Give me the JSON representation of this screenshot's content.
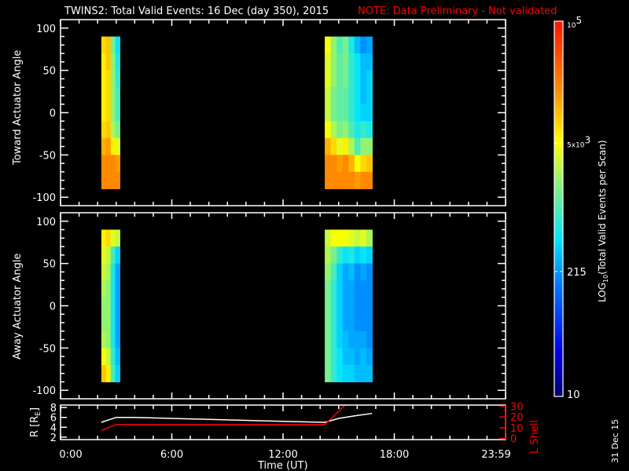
{
  "header": {
    "title": "TWINS2: Total Valid Events: 16 Dec (day 350), 2015",
    "note": "NOTE: Data Preliminary - Not validated",
    "note_color": "#ff0000"
  },
  "side_date": "31 Dec 15",
  "chart_data": [
    {
      "type": "heatmap",
      "ylabel": "Toward Actuator Angle",
      "ylim": [
        -110,
        110
      ],
      "yticks": [
        "100",
        "50",
        "0",
        "-50",
        "-100"
      ],
      "xlim_hours": [
        0,
        24
      ],
      "angle_bins_center": [
        80,
        60,
        40,
        20,
        0,
        -20,
        -40,
        -60,
        -80
      ],
      "angle_bin_width": 20,
      "value_units": "log10 counts",
      "blocks": [
        {
          "start_hours": [
            2.2,
            2.45,
            2.7,
            2.95
          ],
          "col_width_hours": 0.25,
          "columns": [
            [
              3.9,
              3.8,
              3.8,
              3.8,
              3.8,
              3.9,
              4.1,
              4.3,
              4.3
            ],
            [
              4.0,
              4.0,
              3.9,
              3.9,
              3.9,
              4.0,
              4.2,
              4.3,
              4.3
            ],
            [
              3.2,
              3.3,
              3.3,
              3.3,
              3.3,
              3.4,
              3.8,
              4.3,
              4.3
            ],
            [
              2.7,
              2.8,
              2.9,
              3.0,
              3.0,
              3.2,
              3.6,
              4.2,
              4.3
            ]
          ]
        },
        {
          "start_hours": [
            14.25,
            14.57,
            14.89,
            15.21,
            15.53,
            15.85,
            16.17,
            16.49
          ],
          "col_width_hours": 0.32,
          "columns": [
            [
              3.7,
              3.6,
              3.6,
              3.5,
              3.5,
              3.7,
              4.1,
              4.3,
              4.3
            ],
            [
              3.3,
              3.3,
              3.3,
              3.2,
              3.2,
              3.4,
              3.9,
              4.3,
              4.3
            ],
            [
              3.0,
              3.1,
              3.1,
              3.1,
              3.1,
              3.2,
              3.6,
              4.2,
              4.3
            ],
            [
              3.2,
              3.2,
              3.2,
              3.1,
              3.1,
              3.3,
              3.8,
              4.3,
              4.3
            ],
            [
              2.8,
              2.9,
              2.9,
              2.9,
              2.9,
              3.0,
              3.4,
              4.1,
              4.3
            ],
            [
              2.5,
              2.7,
              2.7,
              2.7,
              2.7,
              2.8,
              3.0,
              3.7,
              4.2
            ],
            [
              2.3,
              2.5,
              2.5,
              2.5,
              2.6,
              2.9,
              3.3,
              3.9,
              4.3
            ],
            [
              2.4,
              2.5,
              2.6,
              2.6,
              2.6,
              2.8,
              3.3,
              4.0,
              4.3
            ]
          ]
        }
      ]
    },
    {
      "type": "heatmap",
      "ylabel": "Away Actuator Angle",
      "ylim": [
        -110,
        110
      ],
      "yticks": [
        "100",
        "50",
        "0",
        "-50",
        "-100"
      ],
      "xlim_hours": [
        0,
        24
      ],
      "angle_bins_center": [
        80,
        60,
        40,
        20,
        0,
        -20,
        -40,
        -60,
        -80
      ],
      "angle_bin_width": 20,
      "value_units": "log10 counts",
      "blocks": [
        {
          "start_hours": [
            2.2,
            2.45,
            2.7,
            2.95
          ],
          "col_width_hours": 0.25,
          "columns": [
            [
              3.8,
              3.6,
              3.5,
              3.4,
              3.3,
              3.3,
              3.4,
              3.7,
              4.0
            ],
            [
              3.9,
              3.5,
              3.4,
              3.3,
              3.3,
              3.3,
              3.3,
              3.5,
              3.8
            ],
            [
              3.6,
              3.0,
              2.8,
              2.8,
              2.8,
              2.8,
              2.8,
              2.9,
              3.0
            ],
            [
              3.5,
              2.6,
              2.4,
              2.4,
              2.4,
              2.4,
              2.4,
              2.5,
              2.6
            ]
          ]
        },
        {
          "start_hours": [
            14.25,
            14.57,
            14.89,
            15.21,
            15.53,
            15.85,
            16.17,
            16.49
          ],
          "col_width_hours": 0.32,
          "columns": [
            [
              3.5,
              3.4,
              3.3,
              3.2,
              3.2,
              3.2,
              3.2,
              3.2,
              3.2
            ],
            [
              3.7,
              3.2,
              3.0,
              2.9,
              2.9,
              2.9,
              2.9,
              2.9,
              2.9
            ],
            [
              3.7,
              2.9,
              2.6,
              2.6,
              2.6,
              2.6,
              2.6,
              2.7,
              2.7
            ],
            [
              3.7,
              2.7,
              2.4,
              2.4,
              2.4,
              2.4,
              2.5,
              2.5,
              2.6
            ],
            [
              3.6,
              2.8,
              2.5,
              2.4,
              2.4,
              2.4,
              2.4,
              2.5,
              2.6
            ],
            [
              3.5,
              2.6,
              2.3,
              2.3,
              2.3,
              2.3,
              2.4,
              2.4,
              2.5
            ],
            [
              3.6,
              2.7,
              2.4,
              2.3,
              2.3,
              2.3,
              2.4,
              2.5,
              2.5
            ],
            [
              3.4,
              2.6,
              2.3,
              2.3,
              2.3,
              2.3,
              2.3,
              2.4,
              2.5
            ]
          ]
        }
      ]
    },
    {
      "type": "line",
      "xlabel": "Time (UT)",
      "xticks": [
        "0:00",
        "6:00",
        "12:00",
        "18:00",
        "23:59"
      ],
      "ylabel": "R [RE]",
      "ylabel_main": "R [R",
      "ylabel_sub": "E",
      "ylabel_end": "]",
      "ylim": [
        1.5,
        8.5
      ],
      "yticks": [
        "2",
        "4",
        "6",
        "8"
      ],
      "y2label": "L Shell",
      "y2lim": [
        -1,
        31
      ],
      "y2ticks": [
        "0",
        "10",
        "20",
        "30"
      ],
      "series": [
        {
          "axis": "left",
          "color": "#ffffff",
          "x": [
            2.2,
            3.0,
            4.0,
            6.0,
            8.0,
            10.0,
            12.0,
            14.25,
            15.0,
            16.0,
            16.8
          ],
          "y": [
            5.0,
            6.0,
            6.0,
            5.8,
            5.6,
            5.4,
            5.2,
            5.0,
            5.8,
            6.4,
            6.8
          ]
        },
        {
          "axis": "right",
          "color": "#ff0000",
          "x": [
            2.2,
            3.0,
            14.25,
            15.35
          ],
          "y": [
            7.5,
            13,
            13,
            31
          ]
        }
      ]
    }
  ],
  "colorbar": {
    "label_prefix": "LOG",
    "label_sub": "10",
    "label_rest": "(Total Valid Events per Scan)",
    "range_log10": [
      1,
      5
    ],
    "ticks": [
      {
        "value_log10": 5,
        "base": "10",
        "exp": "5"
      },
      {
        "value_log10": 3.699,
        "base": "5x10",
        "exp": "3"
      },
      {
        "value_log10": 2.332,
        "base": "215",
        "exp": ""
      },
      {
        "value_log10": 1,
        "base": "10",
        "exp": ""
      }
    ]
  }
}
